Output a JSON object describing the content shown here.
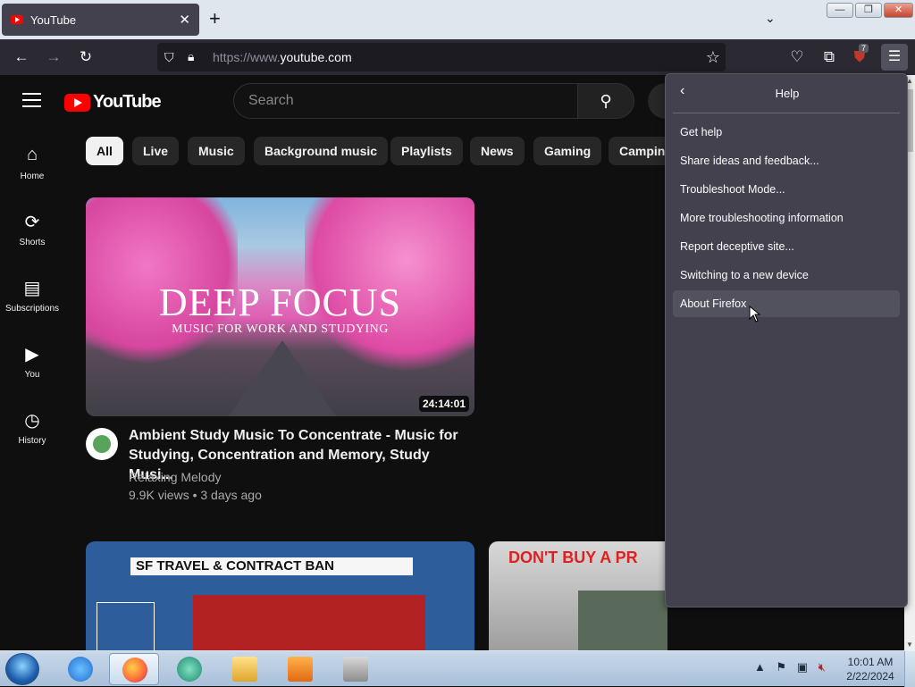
{
  "browser": {
    "tab": {
      "title": "YouTube",
      "close_glyph": "✕"
    },
    "new_tab_glyph": "+",
    "tab_list_glyph": "⌄",
    "window": {
      "minimize": "—",
      "maximize": "❐",
      "close": "✕"
    },
    "nav": {
      "back": "←",
      "forward": "→",
      "reload": "↻"
    },
    "url": {
      "scheme": "https://www.",
      "host": "youtube.com"
    },
    "ublock_count": "7",
    "menu_glyph": "☰"
  },
  "youtube": {
    "logo_text": "YouTube",
    "search_placeholder": "Search",
    "sidebar": [
      {
        "label": "Home",
        "icon": "⌂"
      },
      {
        "label": "Shorts",
        "icon": "⟳"
      },
      {
        "label": "Subscriptions",
        "icon": "▤"
      },
      {
        "label": "You",
        "icon": "▶"
      },
      {
        "label": "History",
        "icon": "◷"
      }
    ],
    "chips": [
      "All",
      "Live",
      "Music",
      "Background music",
      "Playlists",
      "News",
      "Gaming",
      "Camping"
    ],
    "video1": {
      "thumb_title": "DEEP FOCUS",
      "thumb_subtitle": "MUSIC FOR WORK AND STUDYING",
      "duration": "24:14:01",
      "title": "Ambient Study Music To Concentrate - Music for Studying, Concentration and Memory, Study Musi...",
      "channel": "Relaxing Melody",
      "meta": "9.9K views • 3 days ago"
    },
    "video2": {
      "banner": "SF TRAVEL & CONTRACT BAN"
    },
    "video3": {
      "banner": "DON'T BUY A PR"
    }
  },
  "help_panel": {
    "back_glyph": "‹",
    "title": "Help",
    "items": [
      "Get help",
      "Share ideas and feedback...",
      "Troubleshoot Mode...",
      "More troubleshooting information",
      "Report deceptive site...",
      "Switching to a new device",
      "About Firefox"
    ],
    "hovered_index": 6
  },
  "taskbar": {
    "time": "10:01 AM",
    "date": "2/22/2024"
  }
}
